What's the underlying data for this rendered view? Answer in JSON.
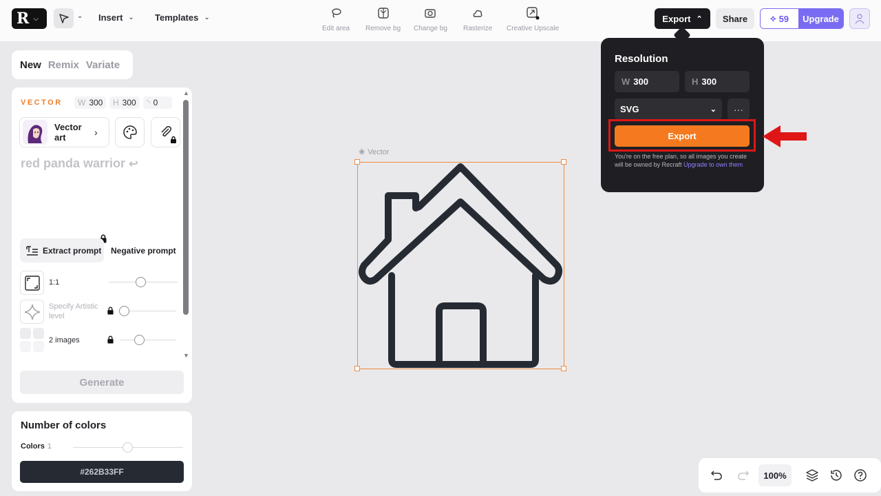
{
  "topbar": {
    "logo_mark": "R",
    "insert_label": "Insert",
    "templates_label": "Templates",
    "tools": [
      {
        "label": "Edit area",
        "icon": "lasso-icon"
      },
      {
        "label": "Remove bg",
        "icon": "remove-bg-icon"
      },
      {
        "label": "Change bg",
        "icon": "change-bg-icon"
      },
      {
        "label": "Rasterize",
        "icon": "rasterize-icon"
      },
      {
        "label": "Creative Upscale",
        "icon": "upscale-icon"
      }
    ],
    "export_label": "Export",
    "share_label": "Share",
    "credits": "59",
    "upgrade_label": "Upgrade"
  },
  "tabs": {
    "new": "New",
    "remix": "Remix",
    "variate": "Variate"
  },
  "panel": {
    "style_type": "VECTOR",
    "w_key": "W",
    "w_val": "300",
    "h_key": "H",
    "h_val": "300",
    "r_val": "0",
    "style_name": "Vector art",
    "prompt_placeholder": "red panda warrior",
    "extract_label": "Extract prompt",
    "negative_label": "Negative prompt",
    "ratio_label": "1:1",
    "artistic_label": "Specify Artistic level",
    "images_label": "2 images",
    "generate_label": "Generate"
  },
  "colors": {
    "title": "Number of colors",
    "label": "Colors",
    "count": "1",
    "swatch_hex": "#262B33FF"
  },
  "canvas": {
    "layer_label": "Vector",
    "stroke_color": "#262b33",
    "selection_color": "#f08a3e"
  },
  "export_popover": {
    "title": "Resolution",
    "w_key": "W",
    "w_val": "300",
    "h_key": "H",
    "h_val": "300",
    "format": "SVG",
    "more": "···",
    "export_label": "Export",
    "note": "You're on the free plan, so all images you create will be owned by Recraft ",
    "note_link": "Upgrade to own them"
  },
  "bottom_bar": {
    "zoom": "100%"
  },
  "colors_theme": {
    "accent_orange": "#f57a1f",
    "brand_purple": "#7a6cf2",
    "highlight_red": "#e01616"
  }
}
